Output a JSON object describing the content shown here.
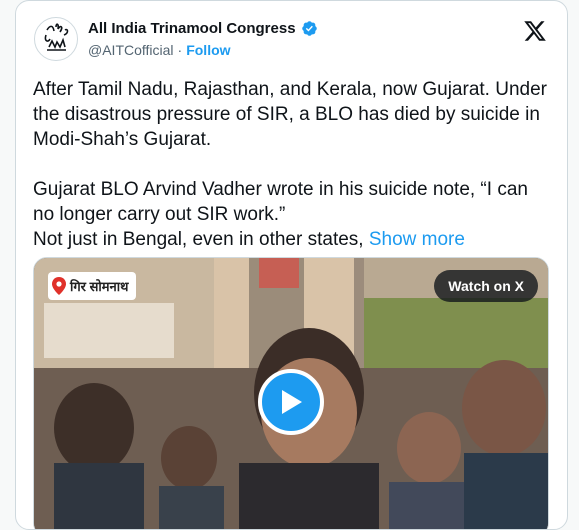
{
  "colors": {
    "accent": "#1d9bf0",
    "text": "#0f1419",
    "muted": "#536471",
    "card_border": "#cfd9de"
  },
  "author": {
    "display_name": "All India Trinamool Congress",
    "handle": "@AITCofficial",
    "separator": "·",
    "follow_label": "Follow",
    "verified": true,
    "avatar_icon": "trinamool-logo-icon"
  },
  "platform_icon": "x-logo-icon",
  "tweet": {
    "paragraph1": "After Tamil Nadu, Rajasthan, and Kerala, now Gujarat. Under the disastrous pressure of SIR, a BLO has died by suicide in Modi-Shah’s Gujarat.",
    "paragraph2_line1": "Gujarat BLO Arvind Vadher wrote in his suicide note, “I can no longer carry out SIR work.”",
    "paragraph2_line2": "Not just in Bengal, even in other states, ",
    "show_more_label": "Show more"
  },
  "media": {
    "location_label": "गिर सोमनाथ",
    "location_icon": "map-pin-icon",
    "watch_label": "Watch on X",
    "play_icon": "play-icon"
  }
}
